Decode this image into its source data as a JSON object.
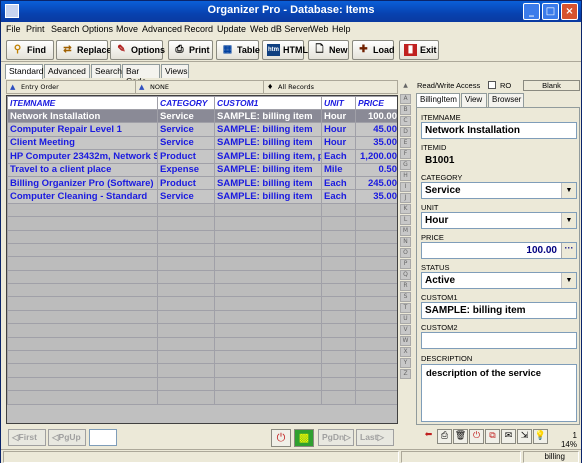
{
  "window": {
    "title": "Organizer Pro - Database: Items",
    "minimize_label": "_",
    "maximize_label": "□",
    "close_label": "×"
  },
  "menu": [
    "File",
    "Print",
    "Search",
    "Options",
    "Move",
    "Advanced",
    "Record",
    "Update",
    "Web dB Server",
    "Web",
    "Help"
  ],
  "toolbar": {
    "find": "Find",
    "replace": "Replace",
    "options": "Options",
    "print": "Print",
    "table": "Table",
    "html": "HTML",
    "new": "New",
    "load": "Load",
    "exit": "Exit"
  },
  "tabs": [
    "Standard",
    "Advanced",
    "Search",
    "Bar Code",
    "Views"
  ],
  "filters": {
    "order": "Entry Order",
    "filter": "NONE",
    "records": "All Records"
  },
  "grid": {
    "columns": [
      "ITEMNAME",
      "CATEGORY",
      "CUSTOM1",
      "UNIT",
      "PRICE"
    ],
    "rows": [
      [
        "Network Installation",
        "Service",
        "SAMPLE: billing item",
        "Hour",
        "100.00"
      ],
      [
        "Computer Repair Level 1",
        "Service",
        "SAMPLE: billing item",
        "Hour",
        "45.00"
      ],
      [
        "Client Meeting",
        "Service",
        "SAMPLE: billing item",
        "Hour",
        "35.00"
      ],
      [
        "HP Computer 23432m, Network St",
        "Product",
        "SAMPLE: billing item, pro",
        "Each",
        "1,200.00"
      ],
      [
        "Travel to a client place",
        "Expense",
        "SAMPLE: billing item",
        "Mile",
        "0.50"
      ],
      [
        "Billing Organizer Pro (Software)",
        "Product",
        "SAMPLE: billing item",
        "Each",
        "245.00"
      ],
      [
        "Computer Cleaning - Standard",
        "Service",
        "SAMPLE: billing item",
        "Each",
        "35.00"
      ]
    ],
    "selected_row": 0
  },
  "nav": {
    "first": "First",
    "pgup": "PgUp",
    "pgdn": "PgDn",
    "last": "Last"
  },
  "letters": [
    "A",
    "B",
    "C",
    "D",
    "E",
    "F",
    "G",
    "H",
    "I",
    "J",
    "K",
    "L",
    "M",
    "N",
    "O",
    "P",
    "Q",
    "R",
    "S",
    "T",
    "U",
    "V",
    "W",
    "X",
    "Y",
    "Z"
  ],
  "rw": {
    "label": "Read/Write Access",
    "ro": "RO",
    "blank": "Blank"
  },
  "right_tabs": [
    "BillingItem",
    "View",
    "Browser"
  ],
  "fields": {
    "itemname_label": "ITEMNAME",
    "itemname": "Network Installation",
    "itemid_label": "ITEMID",
    "itemid": "B1001",
    "category_label": "CATEGORY",
    "category": "Service",
    "unit_label": "UNIT",
    "unit": "Hour",
    "price_label": "PRICE",
    "price": "100.00",
    "status_label": "STATUS",
    "status": "Active",
    "custom1_label": "CUSTOM1",
    "custom1": "SAMPLE: billing item",
    "custom2_label": "CUSTOM2",
    "custom2": "",
    "description_label": "DESCRIPTION",
    "description": "description of the service"
  },
  "status": {
    "count": "1",
    "percent": "14%",
    "user": "billing"
  }
}
